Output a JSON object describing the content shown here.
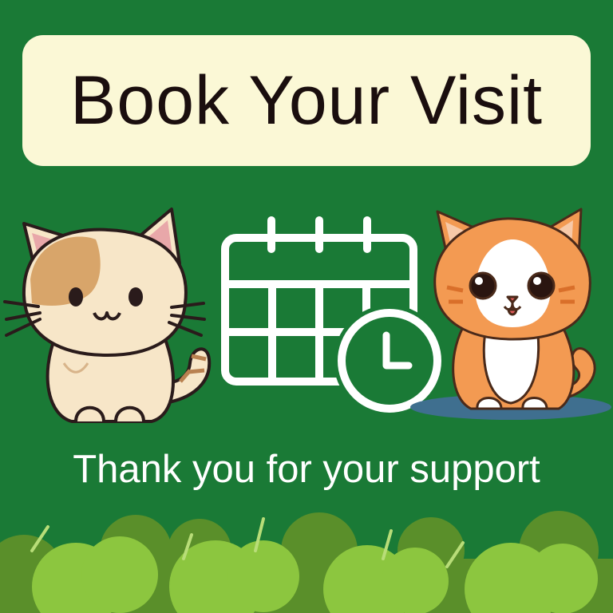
{
  "poster": {
    "title": "Book Your Visit",
    "subtitle": "Thank you for your support"
  },
  "icons": {
    "calendar": "calendar-icon",
    "clock": "clock-icon",
    "left_cat": "cat-illustration",
    "right_cat": "kitten-illustration",
    "bushes": "bushes"
  },
  "colors": {
    "background": "#1a7a36",
    "title_box": "#fbf8d6",
    "title_text": "#1a0e0e",
    "subtitle_text": "#ffffff",
    "bush_light": "#8cc63f",
    "bush_dark": "#5a8f2a"
  }
}
